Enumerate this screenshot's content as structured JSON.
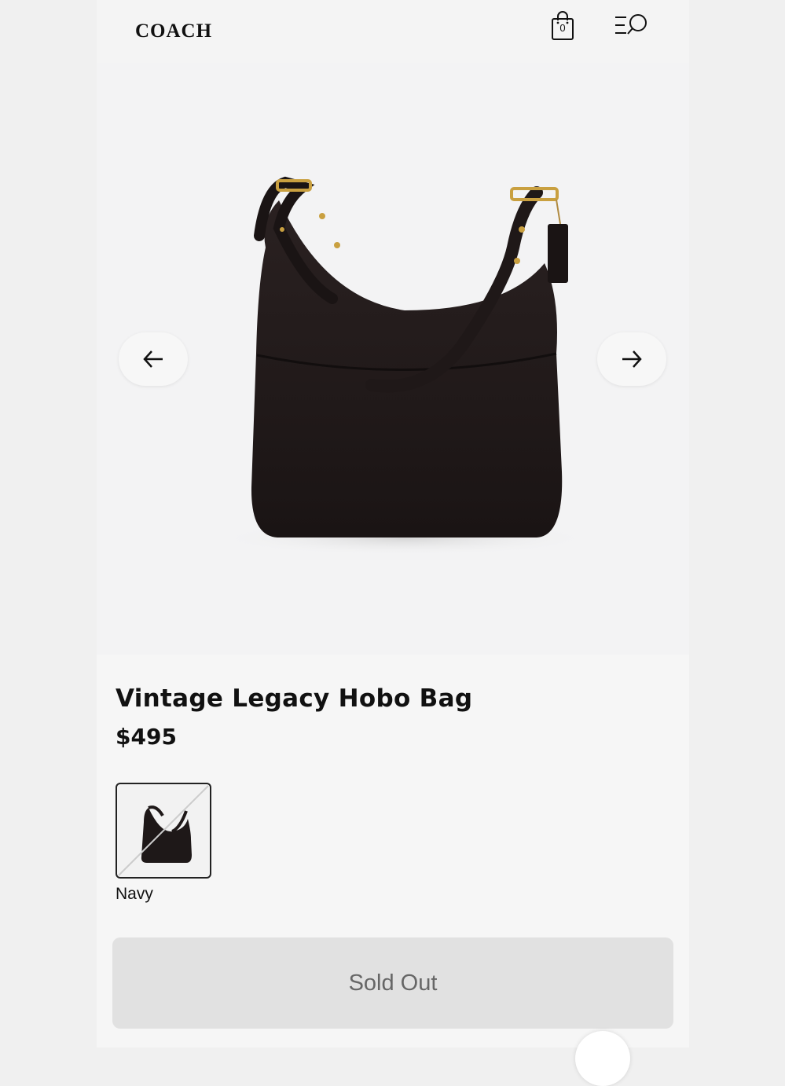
{
  "header": {
    "logo": "COACH",
    "bag_count": "0",
    "bag_icon": "shopping-bag-icon",
    "menu_icon": "menu-search-icon"
  },
  "gallery": {
    "prev_icon": "arrow-left-icon",
    "next_icon": "arrow-right-icon"
  },
  "product": {
    "title": "Vintage Legacy Hobo Bag",
    "price": "$495",
    "swatch_label": "Navy",
    "cta_label": "Sold Out"
  },
  "colors": {
    "background": "#f0f0f0",
    "bag": "#221a1a",
    "hardware": "#c9a040",
    "button_disabled": "#e1e1e1"
  }
}
